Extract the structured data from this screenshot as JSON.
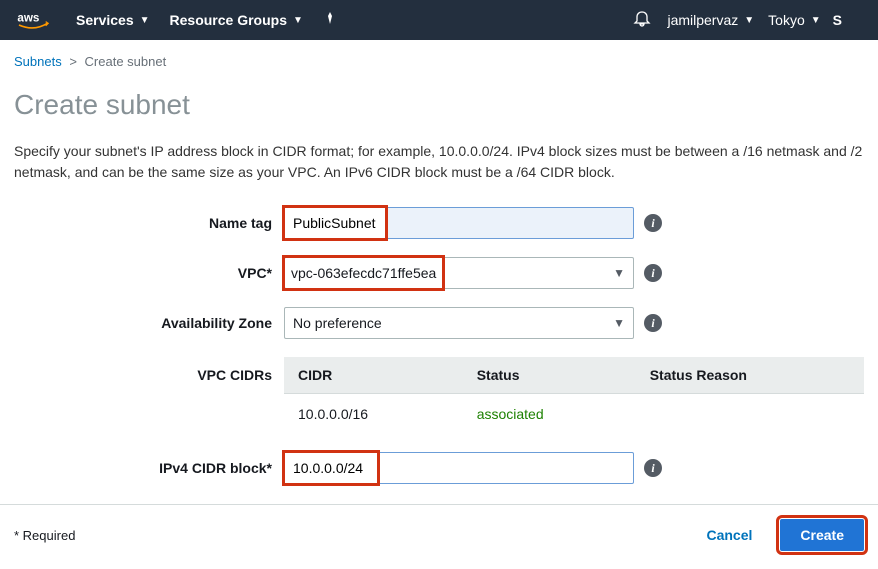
{
  "nav": {
    "services": "Services",
    "resource_groups": "Resource Groups",
    "user": "jamilpervaz",
    "region": "Tokyo",
    "support_letter": "S"
  },
  "breadcrumb": {
    "parent": "Subnets",
    "current": "Create subnet"
  },
  "page_title": "Create subnet",
  "description": "Specify your subnet's IP address block in CIDR format; for example, 10.0.0.0/24. IPv4 block sizes must be between a /16 netmask and /2 netmask, and can be the same size as your VPC. An IPv6 CIDR block must be a /64 CIDR block.",
  "form": {
    "name_tag": {
      "label": "Name tag",
      "value": "PublicSubnet"
    },
    "vpc": {
      "label": "VPC*",
      "value": "vpc-063efecdc71ffe5ea"
    },
    "az": {
      "label": "Availability Zone",
      "value": "No preference"
    },
    "vpc_cidrs_label": "VPC CIDRs",
    "cidr_table": {
      "headers": {
        "cidr": "CIDR",
        "status": "Status",
        "status_reason": "Status Reason"
      },
      "rows": [
        {
          "cidr": "10.0.0.0/16",
          "status": "associated",
          "status_reason": ""
        }
      ]
    },
    "ipv4_cidr": {
      "label": "IPv4 CIDR block*",
      "value": "10.0.0.0/24"
    }
  },
  "footer": {
    "required": "* Required",
    "cancel": "Cancel",
    "create": "Create"
  }
}
